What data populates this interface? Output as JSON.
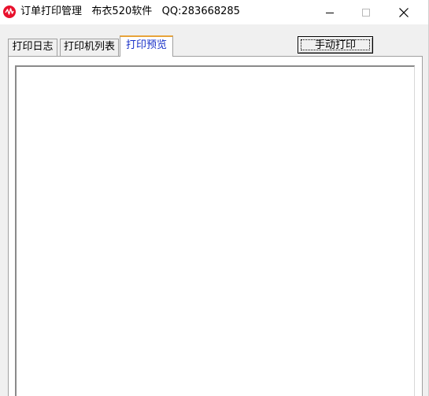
{
  "window": {
    "title": "订单打印管理",
    "subtitle": "布衣520软件",
    "qq": "QQ:283668285",
    "icon": "app-logo-icon",
    "accent_color": "#e8112d"
  },
  "toolbar": {
    "manual_print_label": "手动打印"
  },
  "tabs": [
    {
      "label": "打印日志",
      "active": false
    },
    {
      "label": "打印机列表",
      "active": false
    },
    {
      "label": "打印预览",
      "active": true
    }
  ],
  "colors": {
    "active_tab_text": "#1830c8",
    "active_tab_indicator": "#e8a33a"
  }
}
